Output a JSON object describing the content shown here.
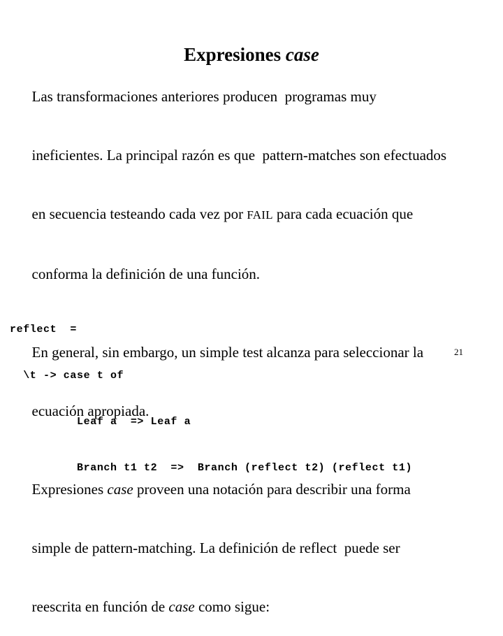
{
  "slide": {
    "title": {
      "text_plain": "Expresiones ",
      "text_italic": "case"
    },
    "paragraphs": [
      {
        "id": "paragraph-intro",
        "lines": [
          [
            {
              "text": "Las transformaciones anteriores producen  programas muy",
              "style": "roman"
            }
          ],
          [
            {
              "text": "ineficientes. La principal razón es que  pattern-matches son efectuados",
              "style": "roman"
            }
          ],
          [
            {
              "text": "en secuencia testeando cada vez por ",
              "style": "roman"
            },
            {
              "text": "FAIL",
              "style": "smallcaps"
            },
            {
              "text": " para cada ecuación que",
              "style": "roman"
            }
          ],
          [
            {
              "text": "conforma la definición de una función.",
              "style": "roman"
            }
          ]
        ]
      },
      {
        "id": "paragraph-general",
        "lines": [
          [
            {
              "text": "En general, sin embargo, un simple test alcanza para seleccionar la",
              "style": "roman"
            }
          ],
          [
            {
              "text": "ecuación apropiada.",
              "style": "roman"
            }
          ]
        ]
      },
      {
        "id": "paragraph-case",
        "lines": [
          [
            {
              "text": "Expresiones ",
              "style": "roman"
            },
            {
              "text": "case",
              "style": "italic"
            },
            {
              "text": " proveen una notación para describir una forma",
              "style": "roman"
            }
          ],
          [
            {
              "text": "simple de pattern-matching. La definición de reflect  puede ser",
              "style": "roman"
            }
          ],
          [
            {
              "text": "reescrita en función de ",
              "style": "roman"
            },
            {
              "text": "case",
              "style": "italic"
            },
            {
              "text": " como sigue:",
              "style": "roman"
            }
          ]
        ]
      }
    ],
    "code": {
      "lines": [
        "reflect  =",
        "  \\t -> case t of",
        "          Leaf a  => Leaf a",
        "          Branch t1 t2  =>  Branch (reflect t2) (reflect t1)"
      ]
    },
    "page_number": "21",
    "colors": {
      "background": "#ffffff",
      "text": "#000000"
    }
  }
}
